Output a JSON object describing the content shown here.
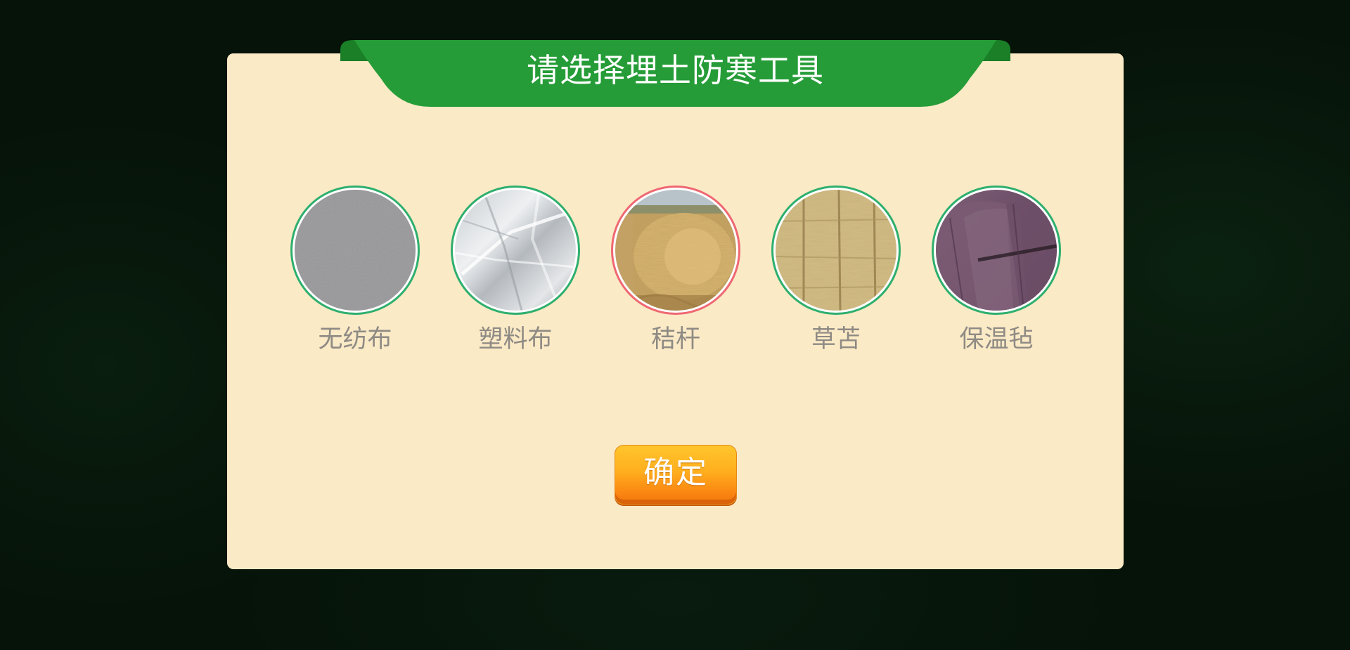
{
  "dialog": {
    "title": "请选择埋土防寒工具",
    "confirm_label": "确定"
  },
  "options": [
    {
      "label": "无纺布",
      "image": "gray-felt-fabric",
      "selected": false
    },
    {
      "label": "塑料布",
      "image": "plastic-sheet",
      "selected": false
    },
    {
      "label": "秸杆",
      "image": "straw-bale",
      "selected": true
    },
    {
      "label": "草苫",
      "image": "straw-mat",
      "selected": false
    },
    {
      "label": "保温毡",
      "image": "purple-insulation-felt",
      "selected": false
    }
  ],
  "colors": {
    "background": "#061309",
    "panel": "#fbeac6",
    "banner": "#259c37",
    "ring_default": "#2eaf6e",
    "ring_selected": "#ef6872",
    "label_text": "#8e8a84",
    "button_top": "#ffc62d",
    "button_bottom": "#f2750c"
  }
}
